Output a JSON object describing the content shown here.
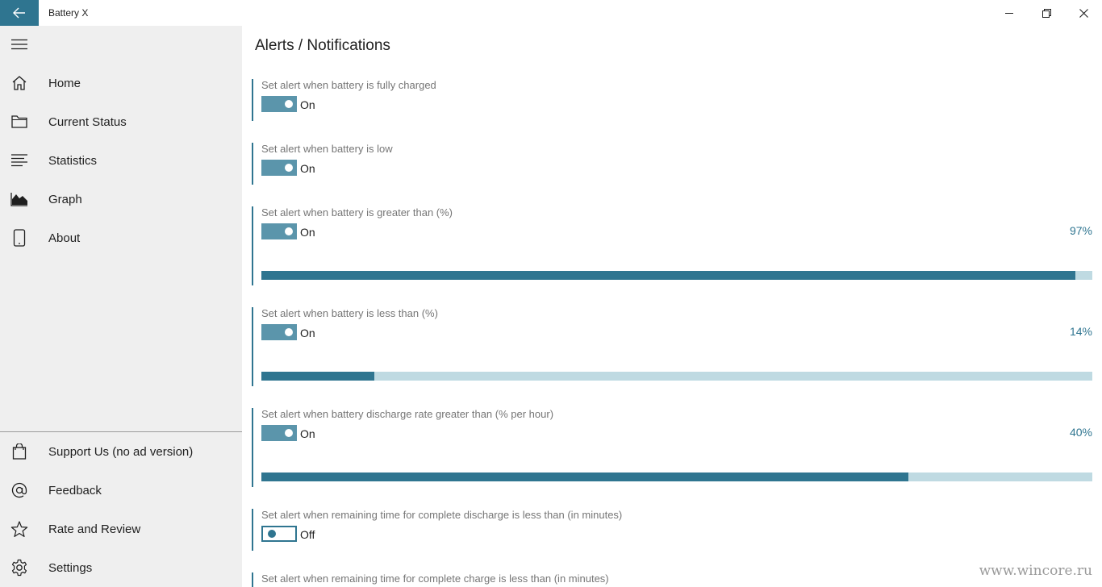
{
  "window": {
    "title": "Battery X",
    "controls": [
      "minimize-icon",
      "restore-icon",
      "close-icon"
    ]
  },
  "sidebar": {
    "items": [
      {
        "label": "Home",
        "icon": "home-icon"
      },
      {
        "label": "Current Status",
        "icon": "folder-icon"
      },
      {
        "label": "Statistics",
        "icon": "list-icon"
      },
      {
        "label": "Graph",
        "icon": "area-chart-icon"
      },
      {
        "label": "About",
        "icon": "tablet-icon"
      }
    ],
    "footer_items": [
      {
        "label": "Support Us (no ad version)",
        "icon": "shopping-bag-icon"
      },
      {
        "label": "Feedback",
        "icon": "at-icon"
      },
      {
        "label": "Rate and Review",
        "icon": "star-icon"
      },
      {
        "label": "Settings",
        "icon": "gear-icon"
      }
    ]
  },
  "main": {
    "title": "Alerts / Notifications",
    "sections": [
      {
        "label": "Set alert when battery is fully charged",
        "state": "On",
        "on": true
      },
      {
        "label": "Set alert when battery is low",
        "state": "On",
        "on": true
      },
      {
        "label": "Set alert when battery is greater than (%)",
        "state": "On",
        "on": true,
        "value_text": "97%",
        "slider_fraction": 0.98
      },
      {
        "label": "Set alert when battery is less than (%)",
        "state": "On",
        "on": true,
        "value_text": "14%",
        "slider_fraction": 0.136
      },
      {
        "label": "Set alert when battery discharge rate greater than (% per hour)",
        "state": "On",
        "on": true,
        "value_text": "40%",
        "slider_fraction": 0.779
      },
      {
        "label": "Set alert when remaining time for complete discharge is less than (in minutes)",
        "state": "Off",
        "on": false
      },
      {
        "label": "Set alert when remaining time for complete charge is less than (in minutes)"
      }
    ]
  },
  "watermark": "www.wincore.ru",
  "colors": {
    "accent": "#2f7590",
    "toggle_on": "#5b95ab",
    "track": "#bfdae2",
    "sidebar_bg": "#efefef"
  }
}
